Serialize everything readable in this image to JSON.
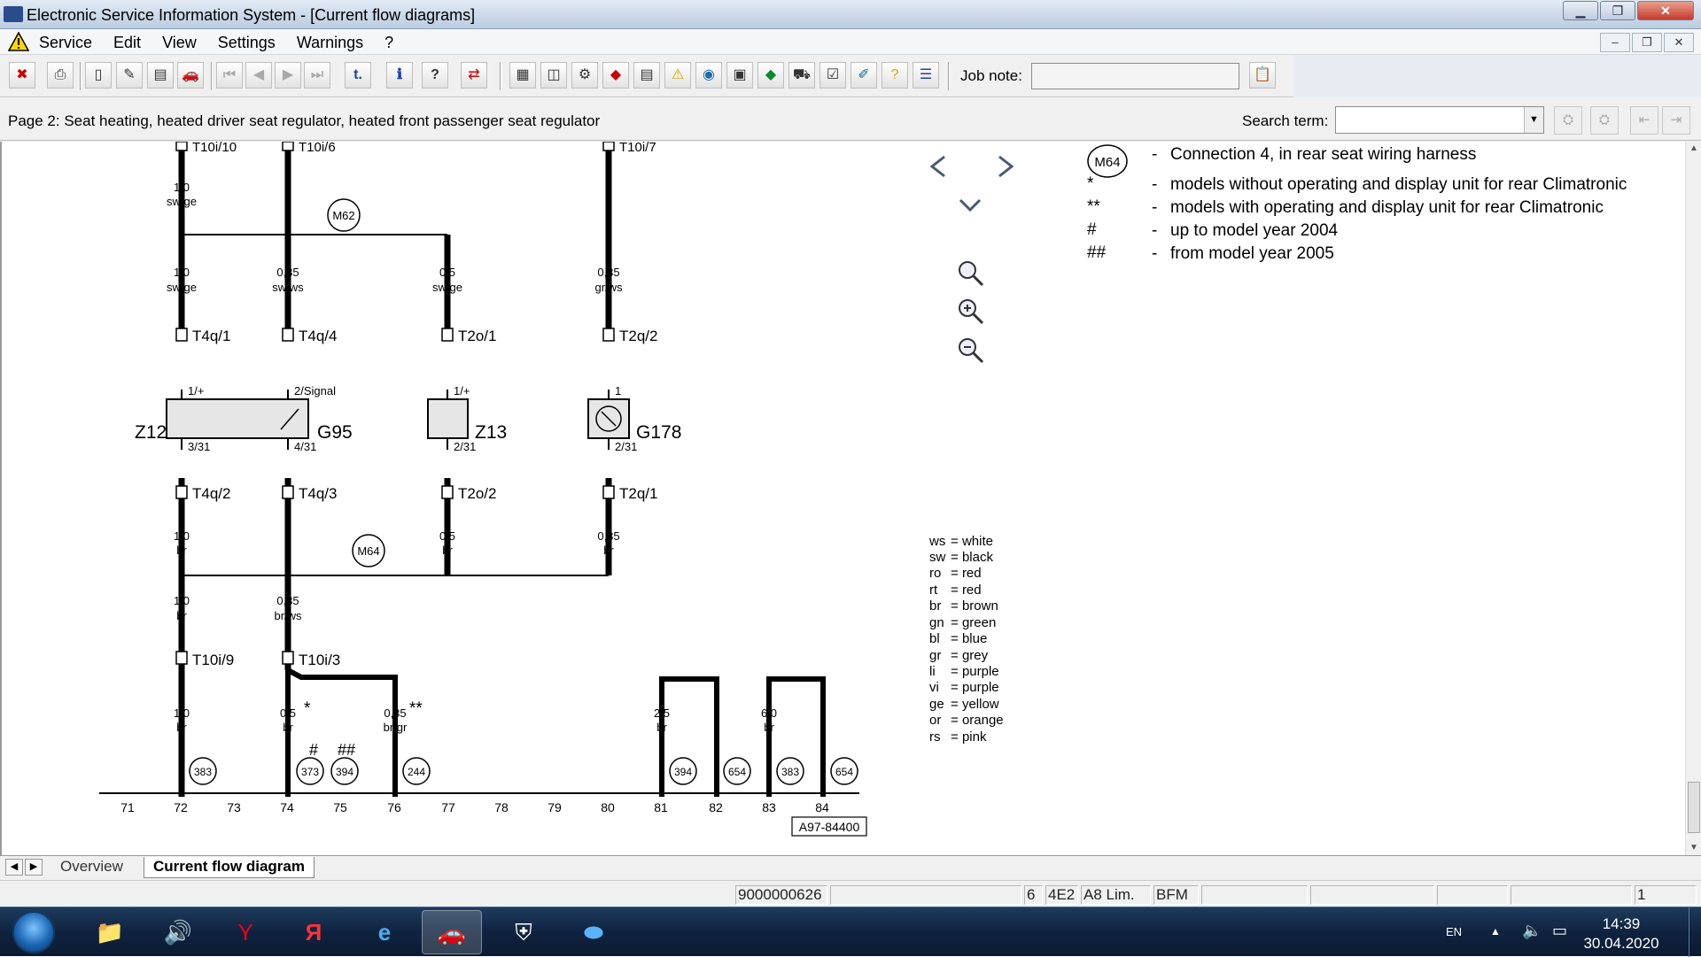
{
  "window": {
    "title": "Electronic Service Information System - [Current flow diagrams]"
  },
  "menu": [
    "Service",
    "Edit",
    "View",
    "Settings",
    "Warnings",
    "?"
  ],
  "toolbar": {
    "job_note_label": "Job note:",
    "job_note_value": ""
  },
  "page": {
    "title": "Page 2: Seat heating, heated driver seat regulator, heated front passenger seat regulator",
    "search_label": "Search term:",
    "search_value": ""
  },
  "diagram": {
    "wires_top": [
      {
        "pin": "T10i/10",
        "cs": "1,0",
        "color": "sw/ge"
      },
      {
        "pin": "T10i/6",
        "cs": "",
        "color": ""
      },
      {
        "pin": "T10i/7",
        "cs": "",
        "color": ""
      }
    ],
    "mid_wires": [
      {
        "cs": "1,0",
        "color": "sw/ge",
        "conn": "T4q/1",
        "pin_top": "1/+",
        "comp": "Z12",
        "pin_bottom": "3/31",
        "conn2": "T4q/2",
        "cs2": "1,0",
        "color2": "br"
      },
      {
        "cs": "0,35",
        "color": "sw/ws",
        "conn": "T4q/4",
        "pin_top": "2/Signal",
        "comp": "G95",
        "pin_bottom": "4/31",
        "conn2": "T4q/3",
        "cs2": "",
        "color2": ""
      },
      {
        "cs": "0,5",
        "color": "sw/ge",
        "conn": "T2o/1",
        "pin_top": "1/+",
        "comp": "Z13",
        "pin_bottom": "2/31",
        "conn2": "T2o/2",
        "cs2": "0,5",
        "color2": "br"
      },
      {
        "cs": "0,35",
        "color": "gr/ws",
        "conn": "T2q/2",
        "pin_top": "1",
        "comp": "G178",
        "pin_bottom": "2/31",
        "conn2": "T2q/1",
        "cs2": "0,35",
        "color2": "br"
      }
    ],
    "lower_wires": [
      {
        "cs": "1,0",
        "color": "br",
        "conn": "T10i/9"
      },
      {
        "cs": "0,35",
        "color": "br/ws",
        "conn": "T10i/3"
      }
    ],
    "bottom_wires": [
      {
        "cs": "1,0",
        "color": "br",
        "mark": ""
      },
      {
        "cs": "0,5",
        "color": "br",
        "mark": "*"
      },
      {
        "cs": "0,35",
        "color": "br/gr",
        "mark": "**"
      },
      {
        "cs": "2,5",
        "color": "br",
        "mark": ""
      },
      {
        "cs": "6,0",
        "color": "br",
        "mark": ""
      }
    ],
    "connections": {
      "m62": "M62",
      "m64": "M64"
    },
    "ground_markers": [
      "383",
      "373",
      "394",
      "244",
      "394",
      "654",
      "383",
      "654"
    ],
    "hash_marks": [
      "#",
      "##"
    ],
    "track_numbers": [
      "71",
      "72",
      "73",
      "74",
      "75",
      "76",
      "77",
      "78",
      "79",
      "80",
      "81",
      "82",
      "83",
      "84"
    ],
    "doc_number": "A97-84400"
  },
  "legend": [
    {
      "key": "M64",
      "text": "Connection 4, in rear seat wiring harness"
    },
    {
      "key": "*",
      "text": "models without operating and display unit for rear Climatronic"
    },
    {
      "key": "**",
      "text": "models with operating and display unit for rear Climatronic"
    },
    {
      "key": "#",
      "text": "up to model year 2004"
    },
    {
      "key": "##",
      "text": "from model year 2005"
    }
  ],
  "legend_dash": "-",
  "color_codes": [
    {
      "code": "ws",
      "name": "white"
    },
    {
      "code": "sw",
      "name": "black"
    },
    {
      "code": "ro",
      "name": "red"
    },
    {
      "code": "rt",
      "name": "red"
    },
    {
      "code": "br",
      "name": "brown"
    },
    {
      "code": "gn",
      "name": "green"
    },
    {
      "code": "bl",
      "name": "blue"
    },
    {
      "code": "gr",
      "name": "grey"
    },
    {
      "code": "li",
      "name": "purple"
    },
    {
      "code": "vi",
      "name": "purple"
    },
    {
      "code": "ge",
      "name": "yellow"
    },
    {
      "code": "or",
      "name": "orange"
    },
    {
      "code": "rs",
      "name": "pink"
    }
  ],
  "tabs": {
    "overview": "Overview",
    "current": "Current flow diagram"
  },
  "status": {
    "vin": "9000000626",
    "num": "6",
    "code": "4E2",
    "model": "A8 Lim.",
    "engine": "BFM",
    "page": "1"
  },
  "taskbar": {
    "lang": "EN",
    "time": "14:39",
    "date": "30.04.2020"
  }
}
